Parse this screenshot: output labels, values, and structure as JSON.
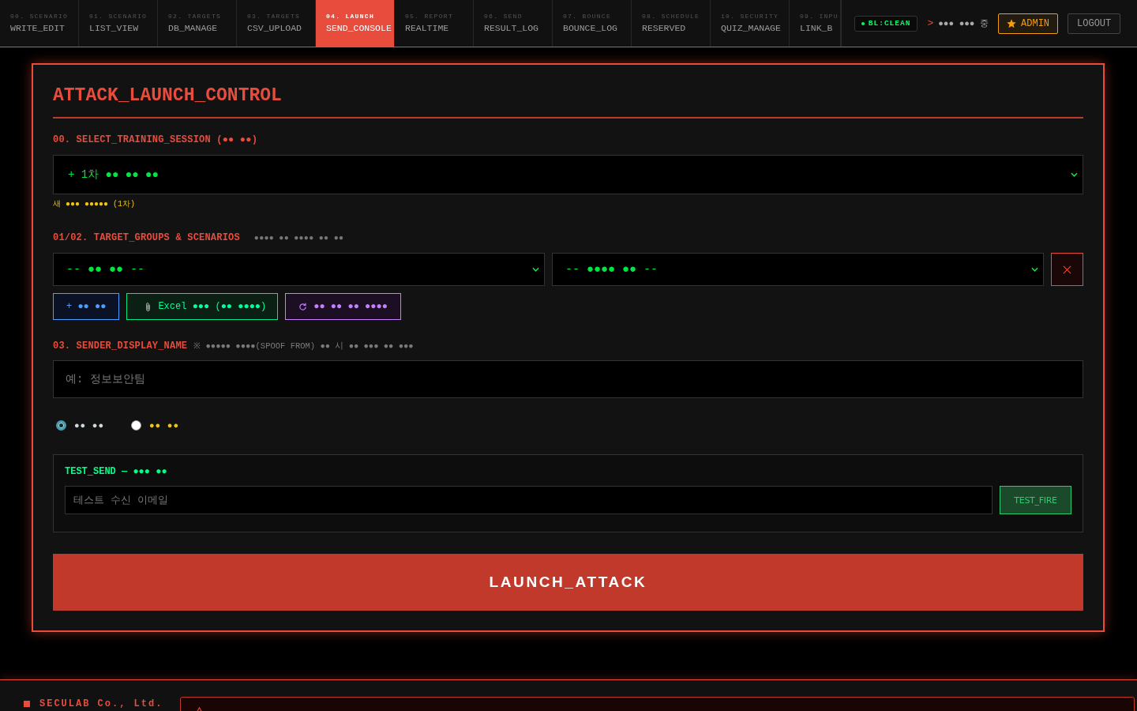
{
  "nav": {
    "tabs": [
      {
        "code": "00. SCENARIO",
        "label": "WRITE_EDIT",
        "selected": false
      },
      {
        "code": "01. SCENARIO",
        "label": "LIST_VIEW",
        "selected": false
      },
      {
        "code": "02. TARGETS",
        "label": "DB_MANAGE",
        "selected": false
      },
      {
        "code": "03. TARGETS",
        "label": "CSV_UPLOAD",
        "selected": false
      },
      {
        "code": "04. LAUNCH",
        "label": "SEND_CONSOLE",
        "selected": true
      },
      {
        "code": "05. REPORT",
        "label": "REALTIME",
        "selected": false
      },
      {
        "code": "06. SEND",
        "label": "RESULT_LOG",
        "selected": false
      },
      {
        "code": "07. BOUNCE",
        "label": "BOUNCE_LOG",
        "selected": false
      },
      {
        "code": "08. SCHEDULE",
        "label": "RESERVED",
        "selected": false
      },
      {
        "code": "10. SECURITY",
        "label": "QUIZ_MANAGE",
        "selected": false
      },
      {
        "code": "09. INPU",
        "label": "LINK_B",
        "selected": false
      }
    ],
    "badge": "BL:CLEAN",
    "prompt": ">",
    "status": "●●● ●●● 중",
    "admin": "ADMIN",
    "logout": "LOGOUT"
  },
  "panel": {
    "title": "ATTACK_LAUNCH_CONTROL",
    "session": {
      "label": "00. SELECT_TRAINING_SESSION (●● ●●)",
      "value": "+ 1차 ●● ●● ●●",
      "hint": "새 ●●● ●●●●● (1차)"
    },
    "targets": {
      "label": "01/02. TARGET_GROUPS & SCENARIOS",
      "note": "●●●● ●● ●●●● ●● ●●",
      "group_select": "-- ●● ●● --",
      "scenario_select": "-- ●●●● ●● --",
      "actions": [
        {
          "kind": "add",
          "label": "+ ●● ●●"
        },
        {
          "kind": "upload",
          "label": "Excel ●●● (●● ●●●●)"
        },
        {
          "kind": "reload",
          "label": "●● ●● ●● ●●●●"
        }
      ]
    },
    "sender": {
      "label": "03. SENDER_DISPLAY_NAME",
      "note": "※ ●●●●● ●●●●(SPOOF FROM) ●● 시 ●● ●●● ●● ●●●",
      "placeholder": "예: 정보보안팀",
      "modes": [
        {
          "label": "●● ●●",
          "selected": true,
          "color": "#cfd8dc"
        },
        {
          "label": "●● ●●",
          "selected": false,
          "color": "#f1c40f"
        }
      ]
    },
    "test_send": {
      "label": "TEST_SEND — ●●● ●●",
      "placeholder": "테스트 수신 이메일",
      "button": "TEST_FIRE"
    },
    "launch_button": "LAUNCH_ATTACK"
  },
  "footer": {
    "company": "SECULAB Co., Ltd."
  }
}
